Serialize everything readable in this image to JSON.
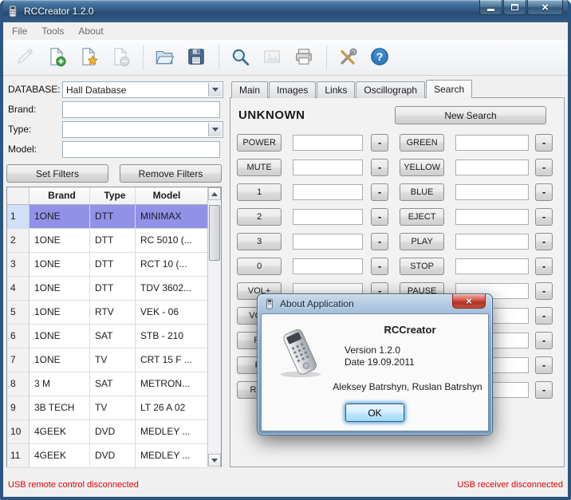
{
  "window": {
    "title": "RCCreator 1.2.0",
    "controls": [
      {
        "name": "minimize-button"
      },
      {
        "name": "maximize-button"
      },
      {
        "name": "close-button"
      }
    ]
  },
  "menu": {
    "file": "File",
    "tools": "Tools",
    "about": "About"
  },
  "toolbar": {
    "icons": [
      {
        "name": "edit-icon",
        "disabled": true
      },
      {
        "name": "new-document-icon",
        "disabled": false
      },
      {
        "name": "favorite-document-icon",
        "disabled": false
      },
      {
        "name": "remove-document-icon",
        "disabled": true
      },
      {
        "name": "open-folder-icon",
        "disabled": false
      },
      {
        "name": "save-icon",
        "disabled": false
      },
      {
        "name": "search-icon",
        "disabled": false
      },
      {
        "name": "image-icon",
        "disabled": true
      },
      {
        "name": "print-icon",
        "disabled": false
      },
      {
        "name": "settings-icon",
        "disabled": false
      },
      {
        "name": "help-icon",
        "disabled": false
      }
    ]
  },
  "filters": {
    "database_label": "DATABASE:",
    "database_value": "Hall Database",
    "brand_label": "Brand:",
    "brand_value": "",
    "type_label": "Type:",
    "type_value": "",
    "model_label": "Model:",
    "model_value": "",
    "set_filters_button": "Set Filters",
    "remove_filters_button": "Remove Filters"
  },
  "table": {
    "headers": {
      "num": "",
      "brand": "Brand",
      "type": "Type",
      "model": "Model"
    },
    "rows": [
      {
        "num": "1",
        "brand": "1ONE",
        "type": "DTT",
        "model": "MINIMAX",
        "selected": true
      },
      {
        "num": "2",
        "brand": "1ONE",
        "type": "DTT",
        "model": "RC 5010 (...",
        "selected": false
      },
      {
        "num": "3",
        "brand": "1ONE",
        "type": "DTT",
        "model": "RCT 10 (...",
        "selected": false
      },
      {
        "num": "4",
        "brand": "1ONE",
        "type": "DTT",
        "model": "TDV 3602...",
        "selected": false
      },
      {
        "num": "5",
        "brand": "1ONE",
        "type": "RTV",
        "model": "VEK - 06",
        "selected": false
      },
      {
        "num": "6",
        "brand": "1ONE",
        "type": "SAT",
        "model": "STB - 210",
        "selected": false
      },
      {
        "num": "7",
        "brand": "1ONE",
        "type": "TV",
        "model": "CRT 15 F ...",
        "selected": false
      },
      {
        "num": "8",
        "brand": "3 M",
        "type": "SAT",
        "model": "METRON...",
        "selected": false
      },
      {
        "num": "9",
        "brand": "3B TECH",
        "type": "TV",
        "model": "LT 26 A 02",
        "selected": false
      },
      {
        "num": "10",
        "brand": "4GEEK",
        "type": "DVD",
        "model": "MEDLEY ...",
        "selected": false
      },
      {
        "num": "11",
        "brand": "4GEEK",
        "type": "DVD",
        "model": "MEDLEY ...",
        "selected": false
      }
    ]
  },
  "tabs": {
    "main": "Main",
    "images": "Images",
    "links": "Links",
    "oscillograph": "Oscillograph",
    "search": "Search",
    "active": "Search"
  },
  "search_page": {
    "heading": "UNKNOWN",
    "new_search_button": "New Search",
    "minus_label": "-",
    "rows": [
      {
        "left_key": "POWER",
        "right_key": "GREEN"
      },
      {
        "left_key": "MUTE",
        "right_key": "YELLOW"
      },
      {
        "left_key": "1",
        "right_key": "BLUE"
      },
      {
        "left_key": "2",
        "right_key": "EJECT"
      },
      {
        "left_key": "3",
        "right_key": "PLAY"
      },
      {
        "left_key": "0",
        "right_key": "STOP"
      },
      {
        "left_key": "VOL+",
        "right_key": "PAUSE"
      },
      {
        "left_key": "VOL-",
        "right_key": ""
      },
      {
        "left_key": "P+",
        "right_key": ""
      },
      {
        "left_key": "P-",
        "right_key": ""
      },
      {
        "left_key": "REC",
        "right_key": ""
      }
    ]
  },
  "about_dialog": {
    "title": "About Application",
    "app_name": "RCCreator",
    "version_line": "Version 1.2.0",
    "date_line": "Date 19.09.2011",
    "authors_line": "Aleksey Batrshyn, Ruslan Batrshyn",
    "ok_button": "OK"
  },
  "statusbar": {
    "left": "USB remote control disconnected",
    "right": "USB receiver disconnected"
  },
  "colors": {
    "titlebar_blue": "#2d567f",
    "selection_purple": "#9191e8",
    "selection_header_blue": "#cfe0f7",
    "status_text_red": "#e60000",
    "close_button_red": "#b03225"
  }
}
